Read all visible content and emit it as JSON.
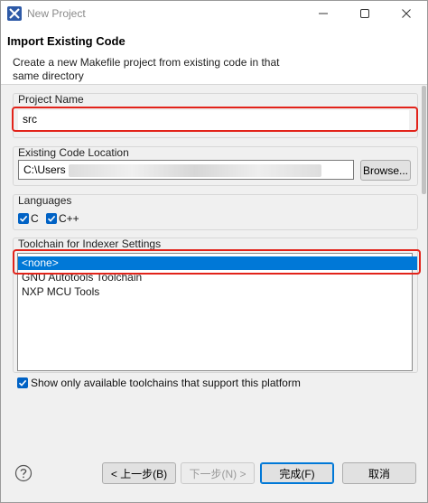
{
  "window": {
    "title": "New Project"
  },
  "header": {
    "title": "Import Existing Code",
    "description": "Create a new Makefile project from existing code in that same directory"
  },
  "project_name": {
    "label": "Project Name",
    "value": "src"
  },
  "code_location": {
    "label": "Existing Code Location",
    "value": "C:\\Users",
    "browse_label": "Browse..."
  },
  "languages": {
    "label": "Languages",
    "items": [
      {
        "label": "C",
        "checked": true
      },
      {
        "label": "C++",
        "checked": true
      }
    ]
  },
  "toolchain": {
    "label": "Toolchain for Indexer Settings",
    "items": [
      "<none>",
      "GNU Autotools Toolchain",
      "NXP MCU Tools"
    ],
    "selected_index": 0
  },
  "platform_filter": {
    "label": "Show only available toolchains that support this platform",
    "checked": true
  },
  "footer": {
    "back_label": "< 上一步(B)",
    "next_label": "下一步(N) >",
    "finish_label": "完成(F)",
    "cancel_label": "取消"
  },
  "colors": {
    "accent": "#0078d7",
    "highlight": "#e2231a"
  },
  "icons": [
    "app-icon",
    "minimize-icon",
    "maximize-icon",
    "close-icon",
    "checkmark-icon",
    "help-icon"
  ]
}
